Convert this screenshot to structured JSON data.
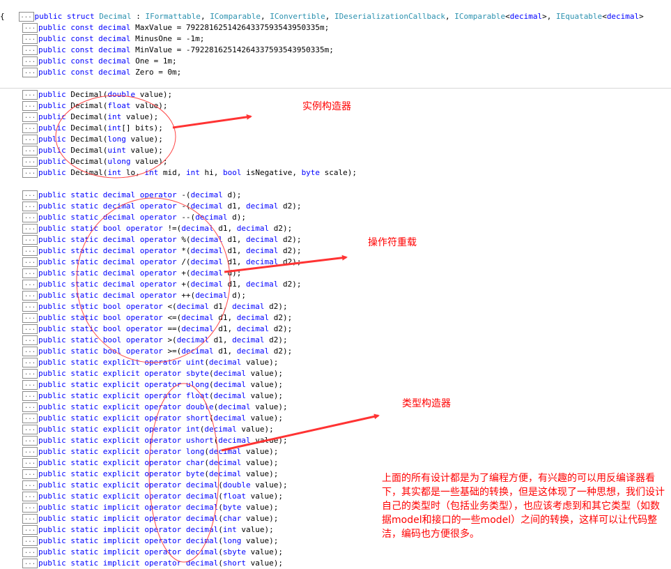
{
  "expander_glyph": "...",
  "header": {
    "tokens": [
      {
        "t": "public struct ",
        "k": "kw"
      },
      {
        "t": "Decimal",
        "k": "ty"
      },
      {
        "t": " : ",
        "k": ""
      },
      {
        "t": "IFormattable",
        "k": "ty"
      },
      {
        "t": ", ",
        "k": ""
      },
      {
        "t": "IComparable",
        "k": "ty"
      },
      {
        "t": ", ",
        "k": ""
      },
      {
        "t": "IConvertible",
        "k": "ty"
      },
      {
        "t": ", ",
        "k": ""
      },
      {
        "t": "IDeserializationCallback",
        "k": "ty"
      },
      {
        "t": ", ",
        "k": ""
      },
      {
        "t": "IComparable",
        "k": "ty"
      },
      {
        "t": "<",
        "k": ""
      },
      {
        "t": "decimal",
        "k": "kw"
      },
      {
        "t": ">, ",
        "k": ""
      },
      {
        "t": "IEquatable",
        "k": "ty"
      },
      {
        "t": "<",
        "k": ""
      },
      {
        "t": "decimal",
        "k": "kw"
      },
      {
        "t": ">",
        "k": ""
      }
    ],
    "brace": "{"
  },
  "constants": [
    [
      {
        "t": "public const decimal ",
        "k": "kw"
      },
      {
        "t": "MaxValue = 79228162514264337593543950335m;",
        "k": ""
      }
    ],
    [
      {
        "t": "public const decimal ",
        "k": "kw"
      },
      {
        "t": "MinusOne = -1m;",
        "k": ""
      }
    ],
    [
      {
        "t": "public const decimal ",
        "k": "kw"
      },
      {
        "t": "MinValue = -79228162514264337593543950335m;",
        "k": ""
      }
    ],
    [
      {
        "t": "public const decimal ",
        "k": "kw"
      },
      {
        "t": "One = 1m;",
        "k": ""
      }
    ],
    [
      {
        "t": "public const decimal ",
        "k": "kw"
      },
      {
        "t": "Zero = 0m;",
        "k": ""
      }
    ]
  ],
  "constructors": [
    [
      {
        "t": "public ",
        "k": "kw"
      },
      {
        "t": "Decimal(",
        "k": ""
      },
      {
        "t": "double",
        "k": "kw"
      },
      {
        "t": " value);",
        "k": ""
      }
    ],
    [
      {
        "t": "public ",
        "k": "kw"
      },
      {
        "t": "Decimal(",
        "k": ""
      },
      {
        "t": "float",
        "k": "kw"
      },
      {
        "t": " value);",
        "k": ""
      }
    ],
    [
      {
        "t": "public ",
        "k": "kw"
      },
      {
        "t": "Decimal(",
        "k": ""
      },
      {
        "t": "int",
        "k": "kw"
      },
      {
        "t": " value);",
        "k": ""
      }
    ],
    [
      {
        "t": "public ",
        "k": "kw"
      },
      {
        "t": "Decimal(",
        "k": ""
      },
      {
        "t": "int",
        "k": "kw"
      },
      {
        "t": "[] bits);",
        "k": ""
      }
    ],
    [
      {
        "t": "public ",
        "k": "kw"
      },
      {
        "t": "Decimal(",
        "k": ""
      },
      {
        "t": "long",
        "k": "kw"
      },
      {
        "t": " value);",
        "k": ""
      }
    ],
    [
      {
        "t": "public ",
        "k": "kw"
      },
      {
        "t": "Decimal(",
        "k": ""
      },
      {
        "t": "uint",
        "k": "kw"
      },
      {
        "t": " value);",
        "k": ""
      }
    ],
    [
      {
        "t": "public ",
        "k": "kw"
      },
      {
        "t": "Decimal(",
        "k": ""
      },
      {
        "t": "ulong",
        "k": "kw"
      },
      {
        "t": " value);",
        "k": ""
      }
    ],
    [
      {
        "t": "public ",
        "k": "kw"
      },
      {
        "t": "Decimal(",
        "k": ""
      },
      {
        "t": "int",
        "k": "kw"
      },
      {
        "t": " lo, ",
        "k": ""
      },
      {
        "t": "int",
        "k": "kw"
      },
      {
        "t": " mid, ",
        "k": ""
      },
      {
        "t": "int",
        "k": "kw"
      },
      {
        "t": " hi, ",
        "k": ""
      },
      {
        "t": "bool",
        "k": "kw"
      },
      {
        "t": " isNegative, ",
        "k": ""
      },
      {
        "t": "byte",
        "k": "kw"
      },
      {
        "t": " scale);",
        "k": ""
      }
    ]
  ],
  "operators": [
    [
      {
        "t": "public static decimal operator ",
        "k": "kw"
      },
      {
        "t": "-(",
        "k": ""
      },
      {
        "t": "decimal",
        "k": "kw"
      },
      {
        "t": " d);",
        "k": ""
      }
    ],
    [
      {
        "t": "public static decimal operator ",
        "k": "kw"
      },
      {
        "t": "-(",
        "k": ""
      },
      {
        "t": "decimal",
        "k": "kw"
      },
      {
        "t": " d1, ",
        "k": ""
      },
      {
        "t": "decimal",
        "k": "kw"
      },
      {
        "t": " d2);",
        "k": ""
      }
    ],
    [
      {
        "t": "public static decimal operator ",
        "k": "kw"
      },
      {
        "t": "--(",
        "k": ""
      },
      {
        "t": "decimal",
        "k": "kw"
      },
      {
        "t": " d);",
        "k": ""
      }
    ],
    [
      {
        "t": "public static bool operator ",
        "k": "kw"
      },
      {
        "t": "!=(",
        "k": ""
      },
      {
        "t": "decimal",
        "k": "kw"
      },
      {
        "t": " d1, ",
        "k": ""
      },
      {
        "t": "decimal",
        "k": "kw"
      },
      {
        "t": " d2);",
        "k": ""
      }
    ],
    [
      {
        "t": "public static decimal operator ",
        "k": "kw"
      },
      {
        "t": "%(",
        "k": ""
      },
      {
        "t": "decimal",
        "k": "kw"
      },
      {
        "t": " d1, ",
        "k": ""
      },
      {
        "t": "decimal",
        "k": "kw"
      },
      {
        "t": " d2);",
        "k": ""
      }
    ],
    [
      {
        "t": "public static decimal operator ",
        "k": "kw"
      },
      {
        "t": "*(",
        "k": ""
      },
      {
        "t": "decimal",
        "k": "kw"
      },
      {
        "t": " d1, ",
        "k": ""
      },
      {
        "t": "decimal",
        "k": "kw"
      },
      {
        "t": " d2);",
        "k": ""
      }
    ],
    [
      {
        "t": "public static decimal operator ",
        "k": "kw"
      },
      {
        "t": "/(",
        "k": ""
      },
      {
        "t": "decimal",
        "k": "kw"
      },
      {
        "t": " d1, ",
        "k": ""
      },
      {
        "t": "decimal",
        "k": "kw"
      },
      {
        "t": " d2);",
        "k": ""
      }
    ],
    [
      {
        "t": "public static decimal operator ",
        "k": "kw"
      },
      {
        "t": "+(",
        "k": ""
      },
      {
        "t": "decimal",
        "k": "kw"
      },
      {
        "t": " d);",
        "k": ""
      }
    ],
    [
      {
        "t": "public static decimal operator ",
        "k": "kw"
      },
      {
        "t": "+(",
        "k": ""
      },
      {
        "t": "decimal",
        "k": "kw"
      },
      {
        "t": " d1, ",
        "k": ""
      },
      {
        "t": "decimal",
        "k": "kw"
      },
      {
        "t": " d2);",
        "k": ""
      }
    ],
    [
      {
        "t": "public static decimal operator ",
        "k": "kw"
      },
      {
        "t": "++(",
        "k": ""
      },
      {
        "t": "decimal",
        "k": "kw"
      },
      {
        "t": " d);",
        "k": ""
      }
    ],
    [
      {
        "t": "public static bool operator ",
        "k": "kw"
      },
      {
        "t": "<(",
        "k": ""
      },
      {
        "t": "decimal",
        "k": "kw"
      },
      {
        "t": " d1, ",
        "k": ""
      },
      {
        "t": "decimal",
        "k": "kw"
      },
      {
        "t": " d2);",
        "k": ""
      }
    ],
    [
      {
        "t": "public static bool operator ",
        "k": "kw"
      },
      {
        "t": "<=(",
        "k": ""
      },
      {
        "t": "decimal",
        "k": "kw"
      },
      {
        "t": " d1, ",
        "k": ""
      },
      {
        "t": "decimal",
        "k": "kw"
      },
      {
        "t": " d2);",
        "k": ""
      }
    ],
    [
      {
        "t": "public static bool operator ",
        "k": "kw"
      },
      {
        "t": "==(",
        "k": ""
      },
      {
        "t": "decimal",
        "k": "kw"
      },
      {
        "t": " d1, ",
        "k": ""
      },
      {
        "t": "decimal",
        "k": "kw"
      },
      {
        "t": " d2);",
        "k": ""
      }
    ],
    [
      {
        "t": "public static bool operator ",
        "k": "kw"
      },
      {
        "t": ">(",
        "k": ""
      },
      {
        "t": "decimal",
        "k": "kw"
      },
      {
        "t": " d1, ",
        "k": ""
      },
      {
        "t": "decimal",
        "k": "kw"
      },
      {
        "t": " d2);",
        "k": ""
      }
    ],
    [
      {
        "t": "public static bool operator ",
        "k": "kw"
      },
      {
        "t": ">=(",
        "k": ""
      },
      {
        "t": "decimal",
        "k": "kw"
      },
      {
        "t": " d1, ",
        "k": ""
      },
      {
        "t": "decimal",
        "k": "kw"
      },
      {
        "t": " d2);",
        "k": ""
      }
    ],
    [
      {
        "t": "public static explicit operator ",
        "k": "kw"
      },
      {
        "t": "uint",
        "k": "kw"
      },
      {
        "t": "(",
        "k": ""
      },
      {
        "t": "decimal",
        "k": "kw"
      },
      {
        "t": " value);",
        "k": ""
      }
    ],
    [
      {
        "t": "public static explicit operator ",
        "k": "kw"
      },
      {
        "t": "sbyte",
        "k": "kw"
      },
      {
        "t": "(",
        "k": ""
      },
      {
        "t": "decimal",
        "k": "kw"
      },
      {
        "t": " value);",
        "k": ""
      }
    ],
    [
      {
        "t": "public static explicit operator ",
        "k": "kw"
      },
      {
        "t": "ulong",
        "k": "kw"
      },
      {
        "t": "(",
        "k": ""
      },
      {
        "t": "decimal",
        "k": "kw"
      },
      {
        "t": " value);",
        "k": ""
      }
    ],
    [
      {
        "t": "public static explicit operator ",
        "k": "kw"
      },
      {
        "t": "float",
        "k": "kw"
      },
      {
        "t": "(",
        "k": ""
      },
      {
        "t": "decimal",
        "k": "kw"
      },
      {
        "t": " value);",
        "k": ""
      }
    ],
    [
      {
        "t": "public static explicit operator ",
        "k": "kw"
      },
      {
        "t": "double",
        "k": "kw"
      },
      {
        "t": "(",
        "k": ""
      },
      {
        "t": "decimal",
        "k": "kw"
      },
      {
        "t": " value);",
        "k": ""
      }
    ],
    [
      {
        "t": "public static explicit operator ",
        "k": "kw"
      },
      {
        "t": "short",
        "k": "kw"
      },
      {
        "t": "(",
        "k": ""
      },
      {
        "t": "decimal",
        "k": "kw"
      },
      {
        "t": " value);",
        "k": ""
      }
    ],
    [
      {
        "t": "public static explicit operator ",
        "k": "kw"
      },
      {
        "t": "int",
        "k": "kw"
      },
      {
        "t": "(",
        "k": ""
      },
      {
        "t": "decimal",
        "k": "kw"
      },
      {
        "t": " value);",
        "k": ""
      }
    ],
    [
      {
        "t": "public static explicit operator ",
        "k": "kw"
      },
      {
        "t": "ushort",
        "k": "kw"
      },
      {
        "t": "(",
        "k": ""
      },
      {
        "t": "decimal",
        "k": "kw"
      },
      {
        "t": " value);",
        "k": ""
      }
    ],
    [
      {
        "t": "public static explicit operator ",
        "k": "kw"
      },
      {
        "t": "long",
        "k": "kw"
      },
      {
        "t": "(",
        "k": ""
      },
      {
        "t": "decimal",
        "k": "kw"
      },
      {
        "t": " value);",
        "k": ""
      }
    ],
    [
      {
        "t": "public static explicit operator ",
        "k": "kw"
      },
      {
        "t": "char",
        "k": "kw"
      },
      {
        "t": "(",
        "k": ""
      },
      {
        "t": "decimal",
        "k": "kw"
      },
      {
        "t": " value);",
        "k": ""
      }
    ],
    [
      {
        "t": "public static explicit operator ",
        "k": "kw"
      },
      {
        "t": "byte",
        "k": "kw"
      },
      {
        "t": "(",
        "k": ""
      },
      {
        "t": "decimal",
        "k": "kw"
      },
      {
        "t": " value);",
        "k": ""
      }
    ],
    [
      {
        "t": "public static explicit operator ",
        "k": "kw"
      },
      {
        "t": "decimal",
        "k": "kw"
      },
      {
        "t": "(",
        "k": ""
      },
      {
        "t": "double",
        "k": "kw"
      },
      {
        "t": " value);",
        "k": ""
      }
    ],
    [
      {
        "t": "public static explicit operator ",
        "k": "kw"
      },
      {
        "t": "decimal",
        "k": "kw"
      },
      {
        "t": "(",
        "k": ""
      },
      {
        "t": "float",
        "k": "kw"
      },
      {
        "t": " value);",
        "k": ""
      }
    ],
    [
      {
        "t": "public static implicit operator ",
        "k": "kw"
      },
      {
        "t": "decimal",
        "k": "kw"
      },
      {
        "t": "(",
        "k": ""
      },
      {
        "t": "byte",
        "k": "kw"
      },
      {
        "t": " value);",
        "k": ""
      }
    ],
    [
      {
        "t": "public static implicit operator ",
        "k": "kw"
      },
      {
        "t": "decimal",
        "k": "kw"
      },
      {
        "t": "(",
        "k": ""
      },
      {
        "t": "char",
        "k": "kw"
      },
      {
        "t": " value);",
        "k": ""
      }
    ],
    [
      {
        "t": "public static implicit operator ",
        "k": "kw"
      },
      {
        "t": "decimal",
        "k": "kw"
      },
      {
        "t": "(",
        "k": ""
      },
      {
        "t": "int",
        "k": "kw"
      },
      {
        "t": " value);",
        "k": ""
      }
    ],
    [
      {
        "t": "public static implicit operator ",
        "k": "kw"
      },
      {
        "t": "decimal",
        "k": "kw"
      },
      {
        "t": "(",
        "k": ""
      },
      {
        "t": "long",
        "k": "kw"
      },
      {
        "t": " value);",
        "k": ""
      }
    ],
    [
      {
        "t": "public static implicit operator ",
        "k": "kw"
      },
      {
        "t": "decimal",
        "k": "kw"
      },
      {
        "t": "(",
        "k": ""
      },
      {
        "t": "sbyte",
        "k": "kw"
      },
      {
        "t": " value);",
        "k": ""
      }
    ],
    [
      {
        "t": "public static implicit operator ",
        "k": "kw"
      },
      {
        "t": "decimal",
        "k": "kw"
      },
      {
        "t": "(",
        "k": ""
      },
      {
        "t": "short",
        "k": "kw"
      },
      {
        "t": " value);",
        "k": ""
      }
    ]
  ],
  "annotations": {
    "constructors_label": "实例构造器",
    "operators_label": "操作符重载",
    "conversions_label": "类型构造器",
    "note": "上面的所有设计都是为了编程方便，有兴趣的可以用反编译器看下，其实都是一些基础的转换，但是这体现了一种思想，我们设计自己的类型时（包括业务类型），也应该考虑到和其它类型（如数据model和接口的一些model）之间的转换，这样可以让代码整洁，编码也方便很多。"
  },
  "colors": {
    "keyword": "#0000ff",
    "type": "#2b91af",
    "text": "#000000",
    "annotation": "#ff0000"
  }
}
